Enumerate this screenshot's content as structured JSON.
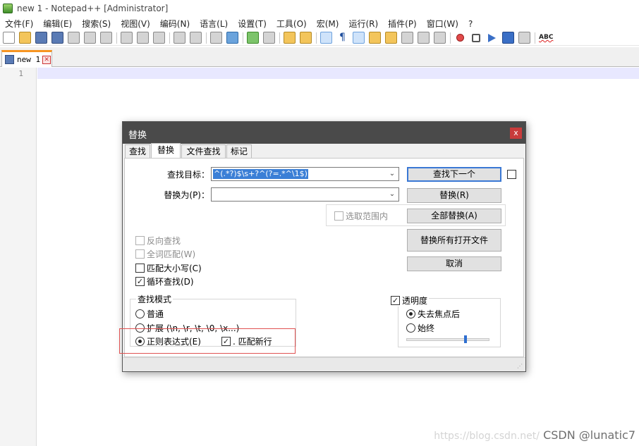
{
  "window": {
    "title": "new 1 - Notepad++ [Administrator]"
  },
  "menu": [
    "文件(F)",
    "编辑(E)",
    "搜索(S)",
    "视图(V)",
    "编码(N)",
    "语言(L)",
    "设置(T)",
    "工具(O)",
    "宏(M)",
    "运行(R)",
    "插件(P)",
    "窗口(W)",
    "?"
  ],
  "tabs": [
    {
      "label": "new 1",
      "close": "✕"
    }
  ],
  "editor": {
    "line_numbers": [
      "1"
    ],
    "colors": {
      "current_line": "#e8e8ff",
      "tab_accent": "#f79521"
    }
  },
  "toolbar": {
    "spellcheck_label": "ABC",
    "pilcrow": "¶"
  },
  "dialog": {
    "title": "替换",
    "close": "x",
    "tabs": [
      "查找",
      "替换",
      "文件查找",
      "标记"
    ],
    "active_tab": "替换",
    "find_label": "查找目标：",
    "find_value": "^(.*?)$\\s+?^(?=.*^\\1$)",
    "replace_label": "替换为(P)：",
    "replace_value": "",
    "dropdown_arrow": "⌄",
    "buttons": {
      "find_next": "查找下一个",
      "replace": "替换(R)",
      "replace_all": "全部替换(A)",
      "replace_all_open": "替换所有打开文件",
      "cancel": "取消"
    },
    "in_selection": "选取范围内",
    "options": {
      "backward": "反向查找",
      "whole_word": "全词匹配(W)",
      "match_case": "匹配大小写(C)",
      "wrap_around": "循环查找(D)"
    },
    "search_mode": {
      "title": "查找模式",
      "normal": "普通",
      "extended": "扩展 (\\n, \\r, \\t, \\0, \\x...)",
      "regex": "正则表达式(E)",
      "dot_newline": ". 匹配新行",
      "selected": "regex"
    },
    "transparency": {
      "title": "透明度",
      "on_lose_focus": "失去焦点后",
      "always": "始终",
      "selected": "on_lose_focus",
      "level": 0.72
    },
    "check_mark": "✓",
    "grip": "⋰"
  },
  "watermark": {
    "light": "https://blog.csdn.net/",
    "main": "CSDN @lunatic7"
  }
}
